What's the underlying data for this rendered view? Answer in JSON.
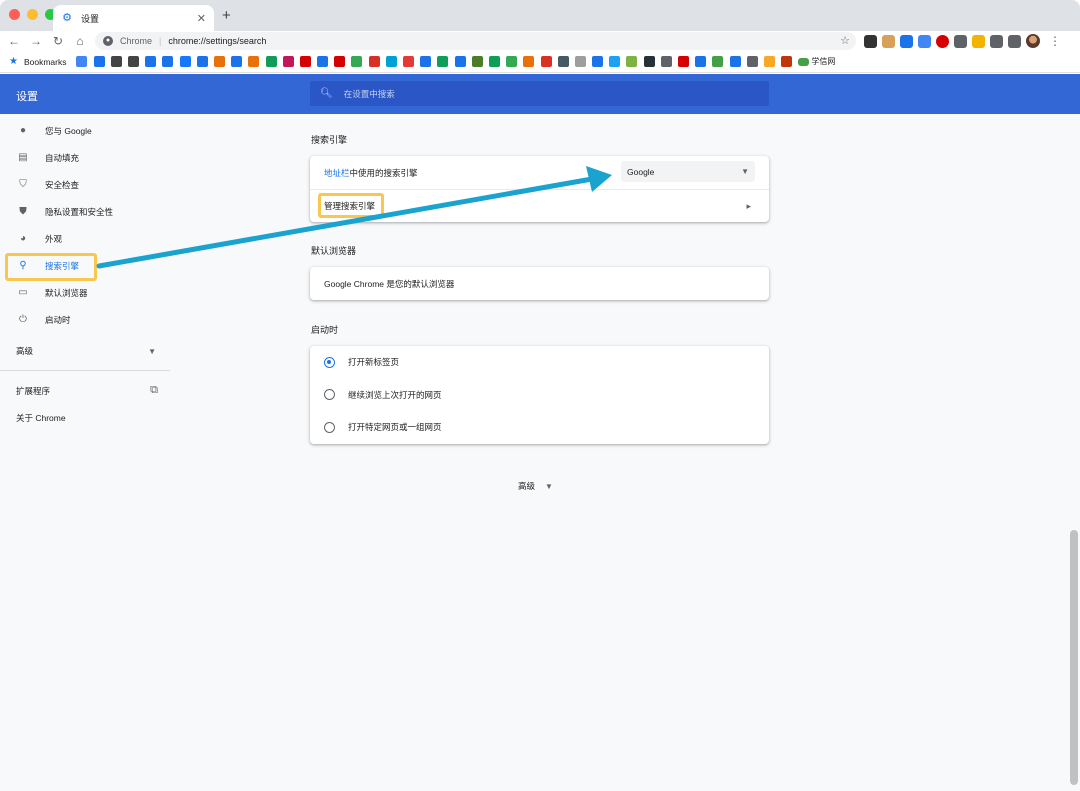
{
  "window": {
    "traffic_lights": [
      "#ff5f57",
      "#febc2e",
      "#28c840"
    ],
    "tab": {
      "title": "设置",
      "icon": "gear-icon"
    }
  },
  "toolbar": {
    "site_label": "Chrome",
    "url": "chrome://settings/search"
  },
  "bookmarks": {
    "label": "Bookmarks",
    "last_label": "学信网",
    "colors": [
      "#4285f4",
      "#1a73e8",
      "#444444",
      "#444444",
      "#1a73e8",
      "#1a73e8",
      "#1677ff",
      "#1a73e8",
      "#e8710a",
      "#1a73e8",
      "#e8710a",
      "#0f9d58",
      "#c2185b",
      "#d50000",
      "#1a73e8",
      "#d50000",
      "#34a853",
      "#d93025",
      "#00a1d6",
      "#e53935",
      "#1a73e8",
      "#0f9d58",
      "#1a73e8",
      "#4e7d2a",
      "#0f9d58",
      "#34a853",
      "#e8710a",
      "#d93025",
      "#455a64",
      "#9e9e9e",
      "#1a73e8",
      "#1da1f2",
      "#7cb342",
      "#263238",
      "#5f6368",
      "#d50000",
      "#1a73e8",
      "#43a047",
      "#1a73e8",
      "#5f6368",
      "#f9a825",
      "#bf360c"
    ]
  },
  "header": {
    "title": "设置",
    "search_placeholder": "在设置中搜索"
  },
  "sidebar": {
    "items": [
      {
        "label": "您与 Google",
        "icon": "person-icon"
      },
      {
        "label": "自动填充",
        "icon": "clipboard-icon"
      },
      {
        "label": "安全检查",
        "icon": "shield-check-icon"
      },
      {
        "label": "隐私设置和安全性",
        "icon": "privacy-shield-icon"
      },
      {
        "label": "外观",
        "icon": "palette-icon"
      },
      {
        "label": "搜索引擎",
        "icon": "search-icon",
        "active": true
      },
      {
        "label": "默认浏览器",
        "icon": "browser-icon"
      },
      {
        "label": "启动时",
        "icon": "power-icon"
      }
    ],
    "advanced": "高级",
    "extensions": "扩展程序",
    "about": "关于 Chrome"
  },
  "search_engine": {
    "section_title": "搜索引擎",
    "address_bar_link": "地址栏",
    "address_bar_rest": "中使用的搜索引擎",
    "selected_engine": "Google",
    "manage": "管理搜索引擎"
  },
  "default_browser": {
    "section_title": "默认浏览器",
    "status": "Google Chrome 是您的默认浏览器"
  },
  "on_startup": {
    "section_title": "启动时",
    "options": [
      {
        "label": "打开新标签页",
        "selected": true
      },
      {
        "label": "继续浏览上次打开的网页",
        "selected": false
      },
      {
        "label": "打开特定网页或一组网页",
        "selected": false
      }
    ]
  },
  "advanced_footer": "高级",
  "annotation_colors": {
    "highlight": "#f9c74f",
    "arrow": "#1aa3cf"
  }
}
